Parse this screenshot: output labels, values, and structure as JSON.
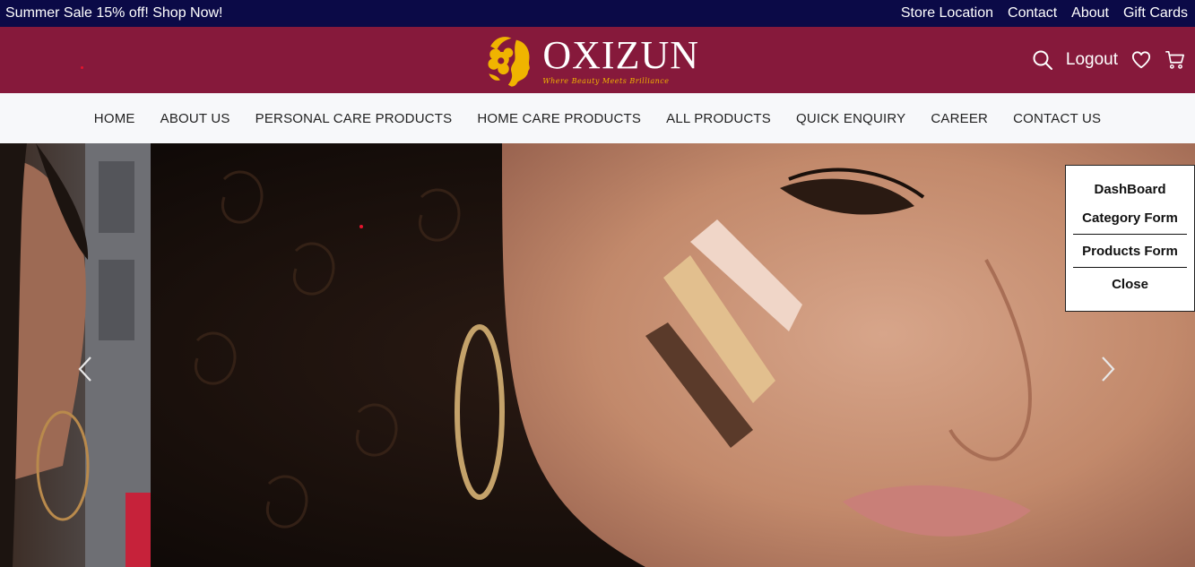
{
  "topbar": {
    "promo": "Summer Sale 15% off! Shop Now!",
    "links": [
      "Store Location",
      "Contact",
      "About",
      "Gift Cards"
    ]
  },
  "brand": {
    "name": "OXIZUN",
    "tagline": "Where Beauty Meets Brilliance"
  },
  "header": {
    "logout_label": "Logout",
    "icons": [
      "search-icon",
      "heart-icon",
      "cart-icon"
    ]
  },
  "nav": {
    "items": [
      "HOME",
      "ABOUT US",
      "PERSONAL CARE PRODUCTS",
      "HOME CARE PRODUCTS",
      "ALL PRODUCTS",
      "QUICK ENQUIRY",
      "CAREER",
      "CONTACT US"
    ]
  },
  "admin_menu": {
    "items": [
      "DashBoard",
      "Category Form",
      "Products Form",
      "Close"
    ]
  },
  "carousel": {
    "prev_icon": "chevron-left-icon",
    "next_icon": "chevron-right-icon"
  },
  "colors": {
    "topbar_bg": "#0b0a47",
    "brand_bg": "#86193b",
    "nav_bg": "#f7f8fa",
    "logo_gold": "#f0b400"
  }
}
